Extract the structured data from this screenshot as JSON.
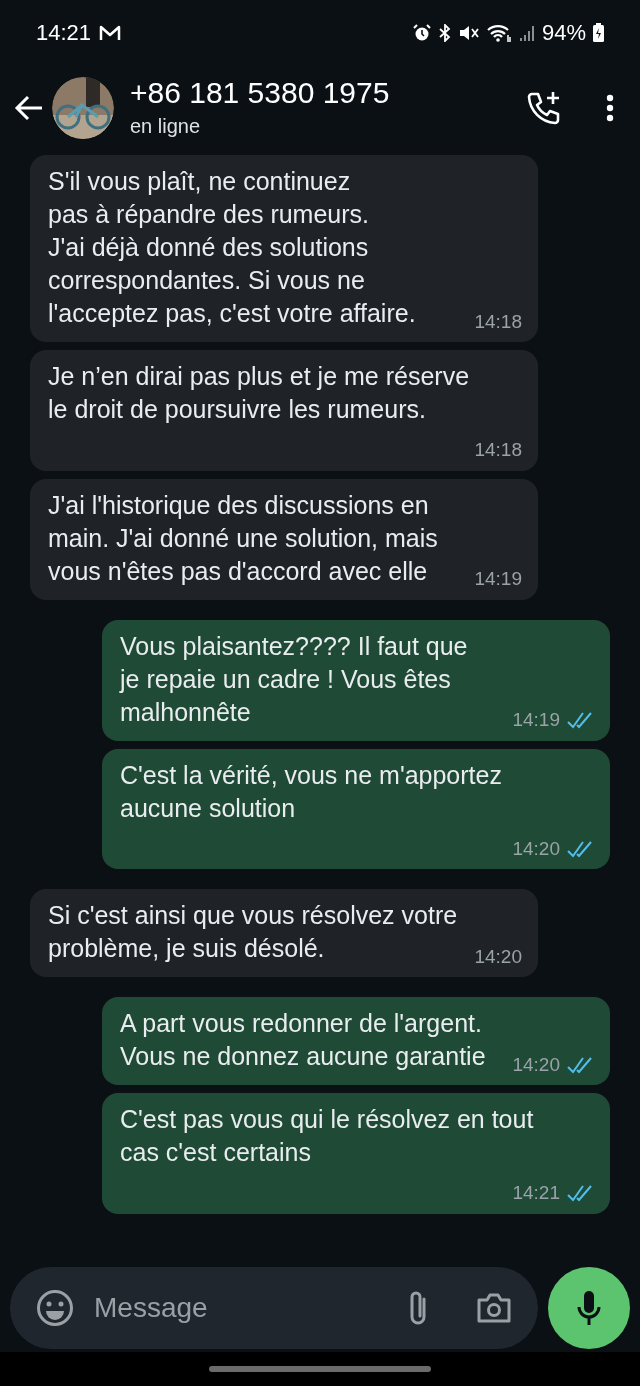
{
  "status_bar": {
    "time": "14:21",
    "battery": "94%"
  },
  "header": {
    "title": "+86 181 5380 1975",
    "subtitle": "en ligne"
  },
  "messages": [
    {
      "kind": "incoming",
      "text": "S'il vous plaît, ne continuez\npas à répandre des rumeurs.\nJ'ai déjà donné des solutions\ncorrespondantes. Si vous ne\nl'acceptez pas, c'est votre affaire.",
      "time": "14:18"
    },
    {
      "kind": "incoming",
      "text": "Je n’en dirai pas plus et je me réserve\nle droit de poursuivre les rumeurs.",
      "time": "14:18"
    },
    {
      "kind": "incoming",
      "text": "J'ai l'historique des discussions en\nmain. J'ai donné une solution, mais\nvous n'êtes pas d'accord avec elle",
      "time": "14:19"
    },
    {
      "kind": "outgoing",
      "text": "Vous plaisantez???? Il faut que\nje repaie un cadre ! Vous êtes\nmalhonnête",
      "time": "14:19",
      "read": true
    },
    {
      "kind": "outgoing",
      "text": "C'est la vérité, vous ne m'apportez\naucune solution",
      "time": "14:20",
      "read": true
    },
    {
      "kind": "incoming",
      "text": "Si c'est ainsi que vous résolvez votre\nproblème, je suis désolé.",
      "time": "14:20"
    },
    {
      "kind": "outgoing",
      "text": "A part vous redonner de l'argent.\nVous ne donnez aucune garantie",
      "time": "14:20",
      "read": true
    },
    {
      "kind": "outgoing",
      "text": "C'est pas vous qui le résolvez en tout\ncas c'est certains",
      "time": "14:21",
      "read": true
    }
  ],
  "composer": {
    "placeholder": "Message"
  }
}
